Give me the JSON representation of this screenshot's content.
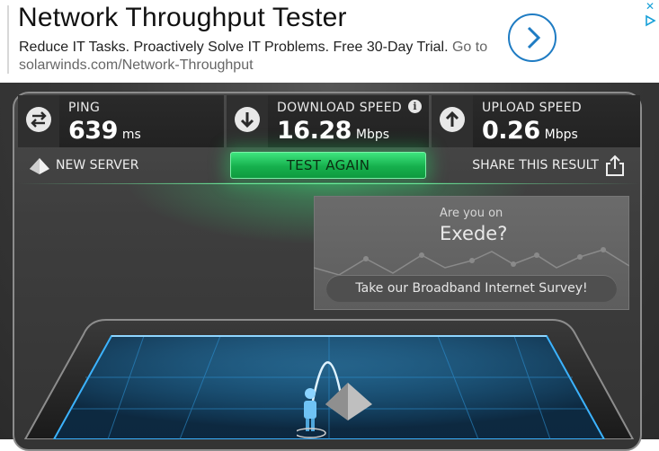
{
  "ad": {
    "title": "Network Throughput Tester",
    "desc_main": "Reduce IT Tasks. Proactively Solve IT Problems. Free 30-Day Trial.",
    "desc_link": "Go to solarwinds.com/Network-Throughput",
    "close_icon": "close-icon",
    "arrow_icon": "chevron-right-icon",
    "accent": "#1f7cc3"
  },
  "stats": {
    "ping": {
      "label": "PING",
      "value": "639",
      "unit": "ms",
      "icon": "exchange-arrows-icon"
    },
    "download": {
      "label": "DOWNLOAD SPEED",
      "value": "16.28",
      "unit": "Mbps",
      "icon": "download-arrow-icon"
    },
    "upload": {
      "label": "UPLOAD SPEED",
      "value": "0.26",
      "unit": "Mbps",
      "icon": "upload-arrow-icon"
    }
  },
  "toolbar": {
    "new_server": "NEW SERVER",
    "test_again": "TEST AGAIN",
    "share": "SHARE THIS RESULT"
  },
  "survey": {
    "question_line1": "Are you on",
    "question_line2": "Exede?",
    "button": "Take our Broadband Internet Survey!"
  },
  "colors": {
    "test_again_green": "#16b04d",
    "panel_dark": "#222222",
    "gauge_blue": "#1e8fd6"
  }
}
